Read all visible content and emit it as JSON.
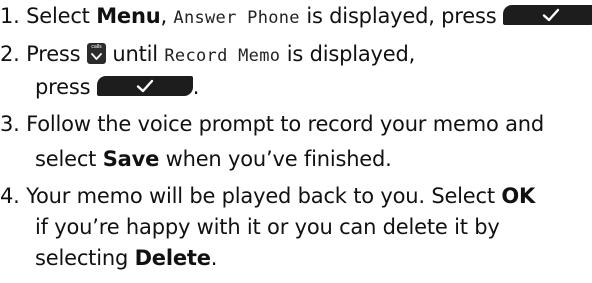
{
  "steps": [
    {
      "number": "1.",
      "select": "Select",
      "menu": "Menu",
      "comma": ",",
      "lcd": "Answer Phone",
      "is_displayed_press": "is displayed, press",
      "end": "."
    },
    {
      "number": "2.",
      "press": "Press",
      "until": "until",
      "lcd": "Record Memo",
      "is_displayed": "is displayed,",
      "press2": "press",
      "end": "."
    },
    {
      "number": "3.",
      "line1": "Follow the voice prompt to record your memo and",
      "select": "select",
      "save": "Save",
      "rest": "when you’ve finished."
    },
    {
      "number": "4.",
      "line1": "Your memo will be played back to you. Select",
      "ok": "OK",
      "line2": "if you’re happy with it or you can delete it by",
      "selecting": "selecting",
      "delete": "Delete",
      "end": "."
    }
  ],
  "keys": {
    "ok_key_icon": "check-mark-icon",
    "calls_key_label": "calls",
    "calls_key_icon": "scroll-down-icon",
    "ok_key_color": "#1d1d1d"
  }
}
